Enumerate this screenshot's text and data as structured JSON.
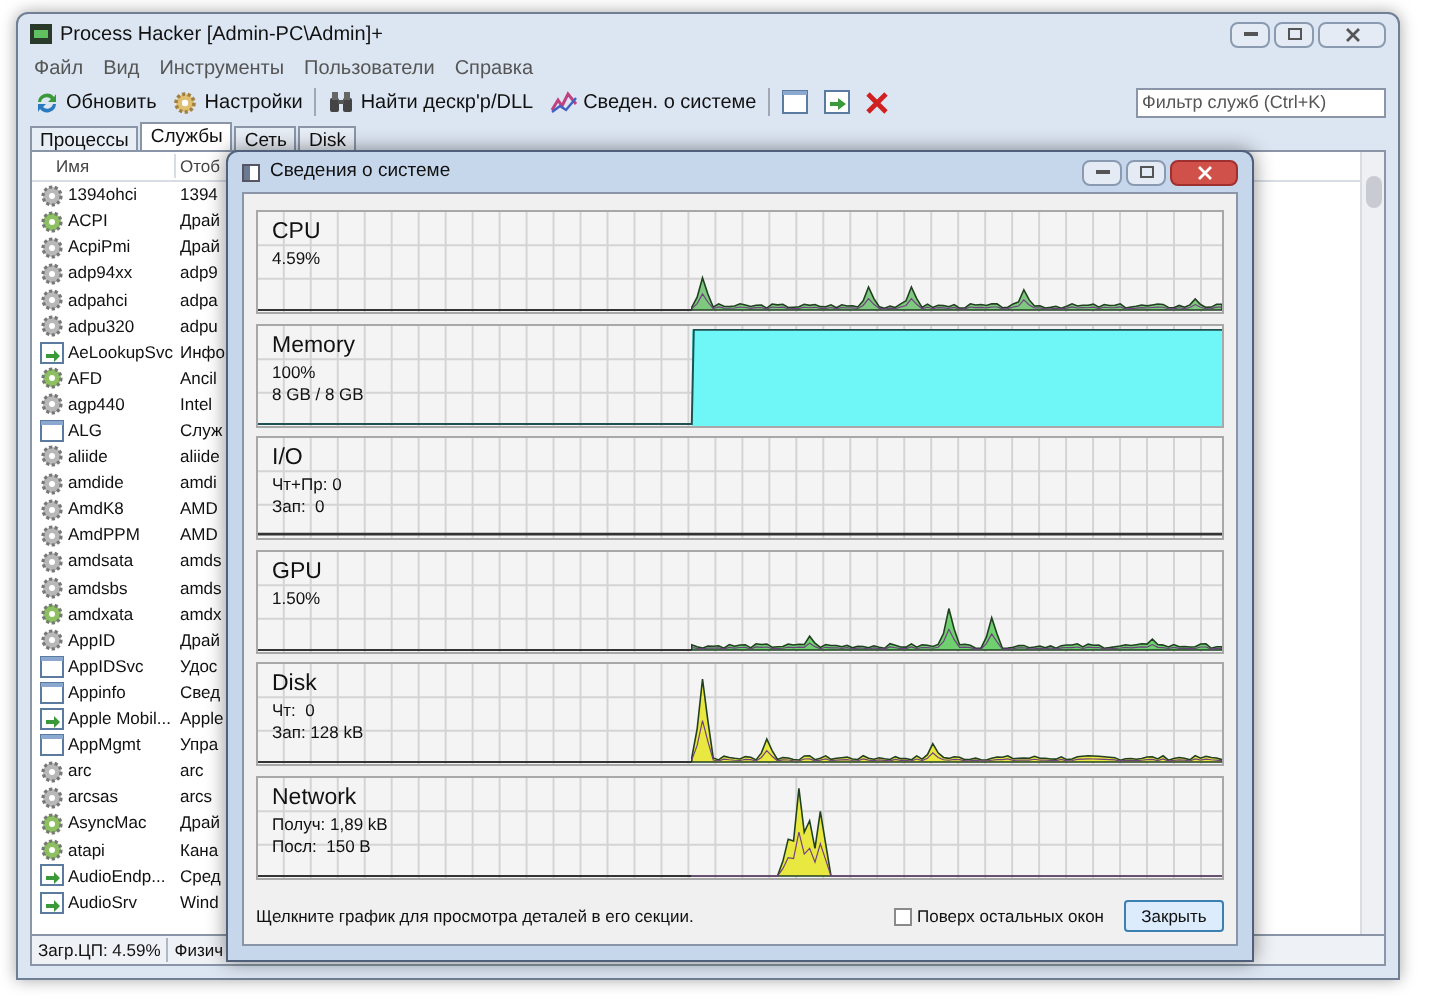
{
  "window": {
    "title": "Process Hacker [Admin-PC\\Admin]+"
  },
  "menu": [
    "Файл",
    "Вид",
    "Инструменты",
    "Пользователи",
    "Справка"
  ],
  "toolbar": [
    {
      "kind": "refresh",
      "label": "Обновить"
    },
    {
      "kind": "settings",
      "label": "Настройки"
    },
    {
      "kind": "find",
      "label": "Найти дескр'р/DLL"
    },
    {
      "kind": "sysinfo",
      "label": "Сведен. о системе"
    },
    {
      "kind": "window"
    },
    {
      "kind": "window_arrow"
    },
    {
      "kind": "close"
    }
  ],
  "filter": {
    "placeholder": "Фильтр служб (Ctrl+K)"
  },
  "tabs": [
    {
      "label": "Процессы",
      "selected": false
    },
    {
      "label": "Службы",
      "selected": true
    },
    {
      "label": "Сеть",
      "selected": false
    },
    {
      "label": "Disk",
      "selected": false
    }
  ],
  "table": {
    "columns": [
      "Имя",
      "Отоб"
    ],
    "rows": [
      {
        "kind": "gear",
        "name": "1394ohci",
        "column_2": "1394"
      },
      {
        "kind": "gear_green",
        "name": "ACPI",
        "column_2": "Драй"
      },
      {
        "kind": "gear",
        "name": "AcpiPmi",
        "column_2": "Драй"
      },
      {
        "kind": "gear",
        "name": "adp94xx",
        "column_2": "adp9"
      },
      {
        "kind": "gear",
        "name": "adpahci",
        "column_2": "adpa"
      },
      {
        "kind": "gear",
        "name": "adpu320",
        "column_2": "adpu"
      },
      {
        "kind": "window_arrow",
        "name": "AeLookupSvc",
        "column_2": "Инфо"
      },
      {
        "kind": "gear_green",
        "name": "AFD",
        "column_2": "Ancil"
      },
      {
        "kind": "gear",
        "name": "agp440",
        "column_2": "Intel"
      },
      {
        "kind": "window",
        "name": "ALG",
        "column_2": "Служ"
      },
      {
        "kind": "gear",
        "name": "aliide",
        "column_2": "aliide"
      },
      {
        "kind": "gear",
        "name": "amdide",
        "column_2": "amdi"
      },
      {
        "kind": "gear",
        "name": "AmdK8",
        "column_2": "AMD"
      },
      {
        "kind": "gear",
        "name": "AmdPPM",
        "column_2": "AMD"
      },
      {
        "kind": "gear",
        "name": "amdsata",
        "column_2": "amds"
      },
      {
        "kind": "gear",
        "name": "amdsbs",
        "column_2": "amds"
      },
      {
        "kind": "gear_green",
        "name": "amdxata",
        "column_2": "amdx"
      },
      {
        "kind": "gear",
        "name": "AppID",
        "column_2": "Драй"
      },
      {
        "kind": "window",
        "name": "AppIDSvc",
        "column_2": "Удос"
      },
      {
        "kind": "window",
        "name": "Appinfo",
        "column_2": "Свед"
      },
      {
        "kind": "window_arrow",
        "name": "Apple Mobil...",
        "column_2": "Apple"
      },
      {
        "kind": "window",
        "name": "AppMgmt",
        "column_2": "Упра"
      },
      {
        "kind": "gear",
        "name": "arc",
        "column_2": "arc"
      },
      {
        "kind": "gear",
        "name": "arcsas",
        "column_2": "arcs"
      },
      {
        "kind": "gear_green",
        "name": "AsyncMac",
        "column_2": "Драй"
      },
      {
        "kind": "gear_green",
        "name": "atapi",
        "column_2": "Кана"
      },
      {
        "kind": "window_arrow",
        "name": "AudioEndp...",
        "column_2": "Сред"
      },
      {
        "kind": "window_arrow",
        "name": "AudioSrv",
        "column_2": "Wind"
      }
    ]
  },
  "status_bar": [
    "Загр.ЦП: 4.59%",
    "Физич"
  ],
  "dialog": {
    "title": "Сведения о системе",
    "panels": [
      {
        "kind": "spikes",
        "title": "CPU",
        "lines": [
          "4.59%"
        ],
        "color": "#7fc87f"
      },
      {
        "kind": "fill",
        "title": "Memory",
        "lines": [
          "100%",
          "8 GB / 8 GB"
        ],
        "color": "#6ff7f7"
      },
      {
        "kind": "flat",
        "title": "I/O",
        "lines": [
          "Чт+Пр: 0",
          "Зап:  0"
        ]
      },
      {
        "kind": "spikes",
        "title": "GPU",
        "lines": [
          "1.50%"
        ],
        "color": "#6fd06f"
      },
      {
        "kind": "spikes",
        "title": "Disk",
        "lines": [
          "Чт:  0",
          "Зап: 128 kB"
        ],
        "color": "#e8e840"
      },
      {
        "kind": "spikes",
        "title": "Network",
        "lines": [
          "Получ: 1,89 kB",
          "Посл:  150 B"
        ],
        "color": "#e8e840"
      }
    ],
    "hint": "Щелкните график для просмотра деталей в его секции.",
    "on_top": {
      "label": "Поверх остальных окон",
      "checked": false
    },
    "close_button": "Закрыть"
  }
}
